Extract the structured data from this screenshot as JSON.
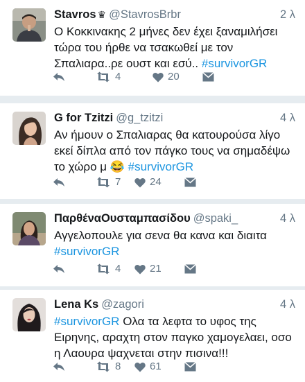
{
  "tweets": [
    {
      "name": "Stavros",
      "verified_glyph": "♛",
      "handle": "@StavrosBrbr",
      "time": "2 λ",
      "text": "Ο Κοκκινακης 2 μήνες δεν έχει ξαναμιλήσει τώρα του ήρθε να τσακωθεί με τον Σπαλιαρα..ρε ουστ και εσύ.. ",
      "hashtag": "#survivorGR",
      "text_after": "",
      "retweets": "4",
      "likes": "20",
      "avatar_icon": "man-photo-avatar"
    },
    {
      "name": "G for Tzitzi",
      "verified_glyph": "",
      "handle": "@g_tzitzi",
      "time": "4 λ",
      "text": "Αν ήμουν ο Σπαλιαρας θα κατουρούσα λίγο εκεί δίπλα από τον πάγκο τους να σημαδέψω το χώρο μ ",
      "emoji": "😂",
      "hashtag": "#survivorGR",
      "text_after": "",
      "retweets": "7",
      "likes": "24",
      "avatar_icon": "woman-photo-avatar"
    },
    {
      "name": "ΠαρθέναΟυσταμπασίδου",
      "verified_glyph": "",
      "handle": "@spaki_",
      "time": "4 λ",
      "text": "Αγγελοπουλε για σενα θα κανα και διαιτα ",
      "hashtag": "#survivorGR",
      "text_after": "",
      "retweets": "4",
      "likes": "21",
      "avatar_icon": "woman-photo-avatar"
    },
    {
      "name": "Lena Ks",
      "verified_glyph": "",
      "handle": "@zagori",
      "time": "4 λ",
      "text": "",
      "hashtag": "#survivorGR",
      "text_after": " Ολα τα λεφτα το υφος της Ειρηνης, αραχτη στον παγκο χαμογελαει, οσο η Λαουρα ψαχνεται στην πισινα!!!",
      "retweets": "8",
      "likes": "61",
      "avatar_icon": "woman-photo-avatar"
    }
  ],
  "colors": {
    "text": "#14171a",
    "muted": "#657786",
    "link": "#1b95e0",
    "divider": "#e6ecf0"
  }
}
